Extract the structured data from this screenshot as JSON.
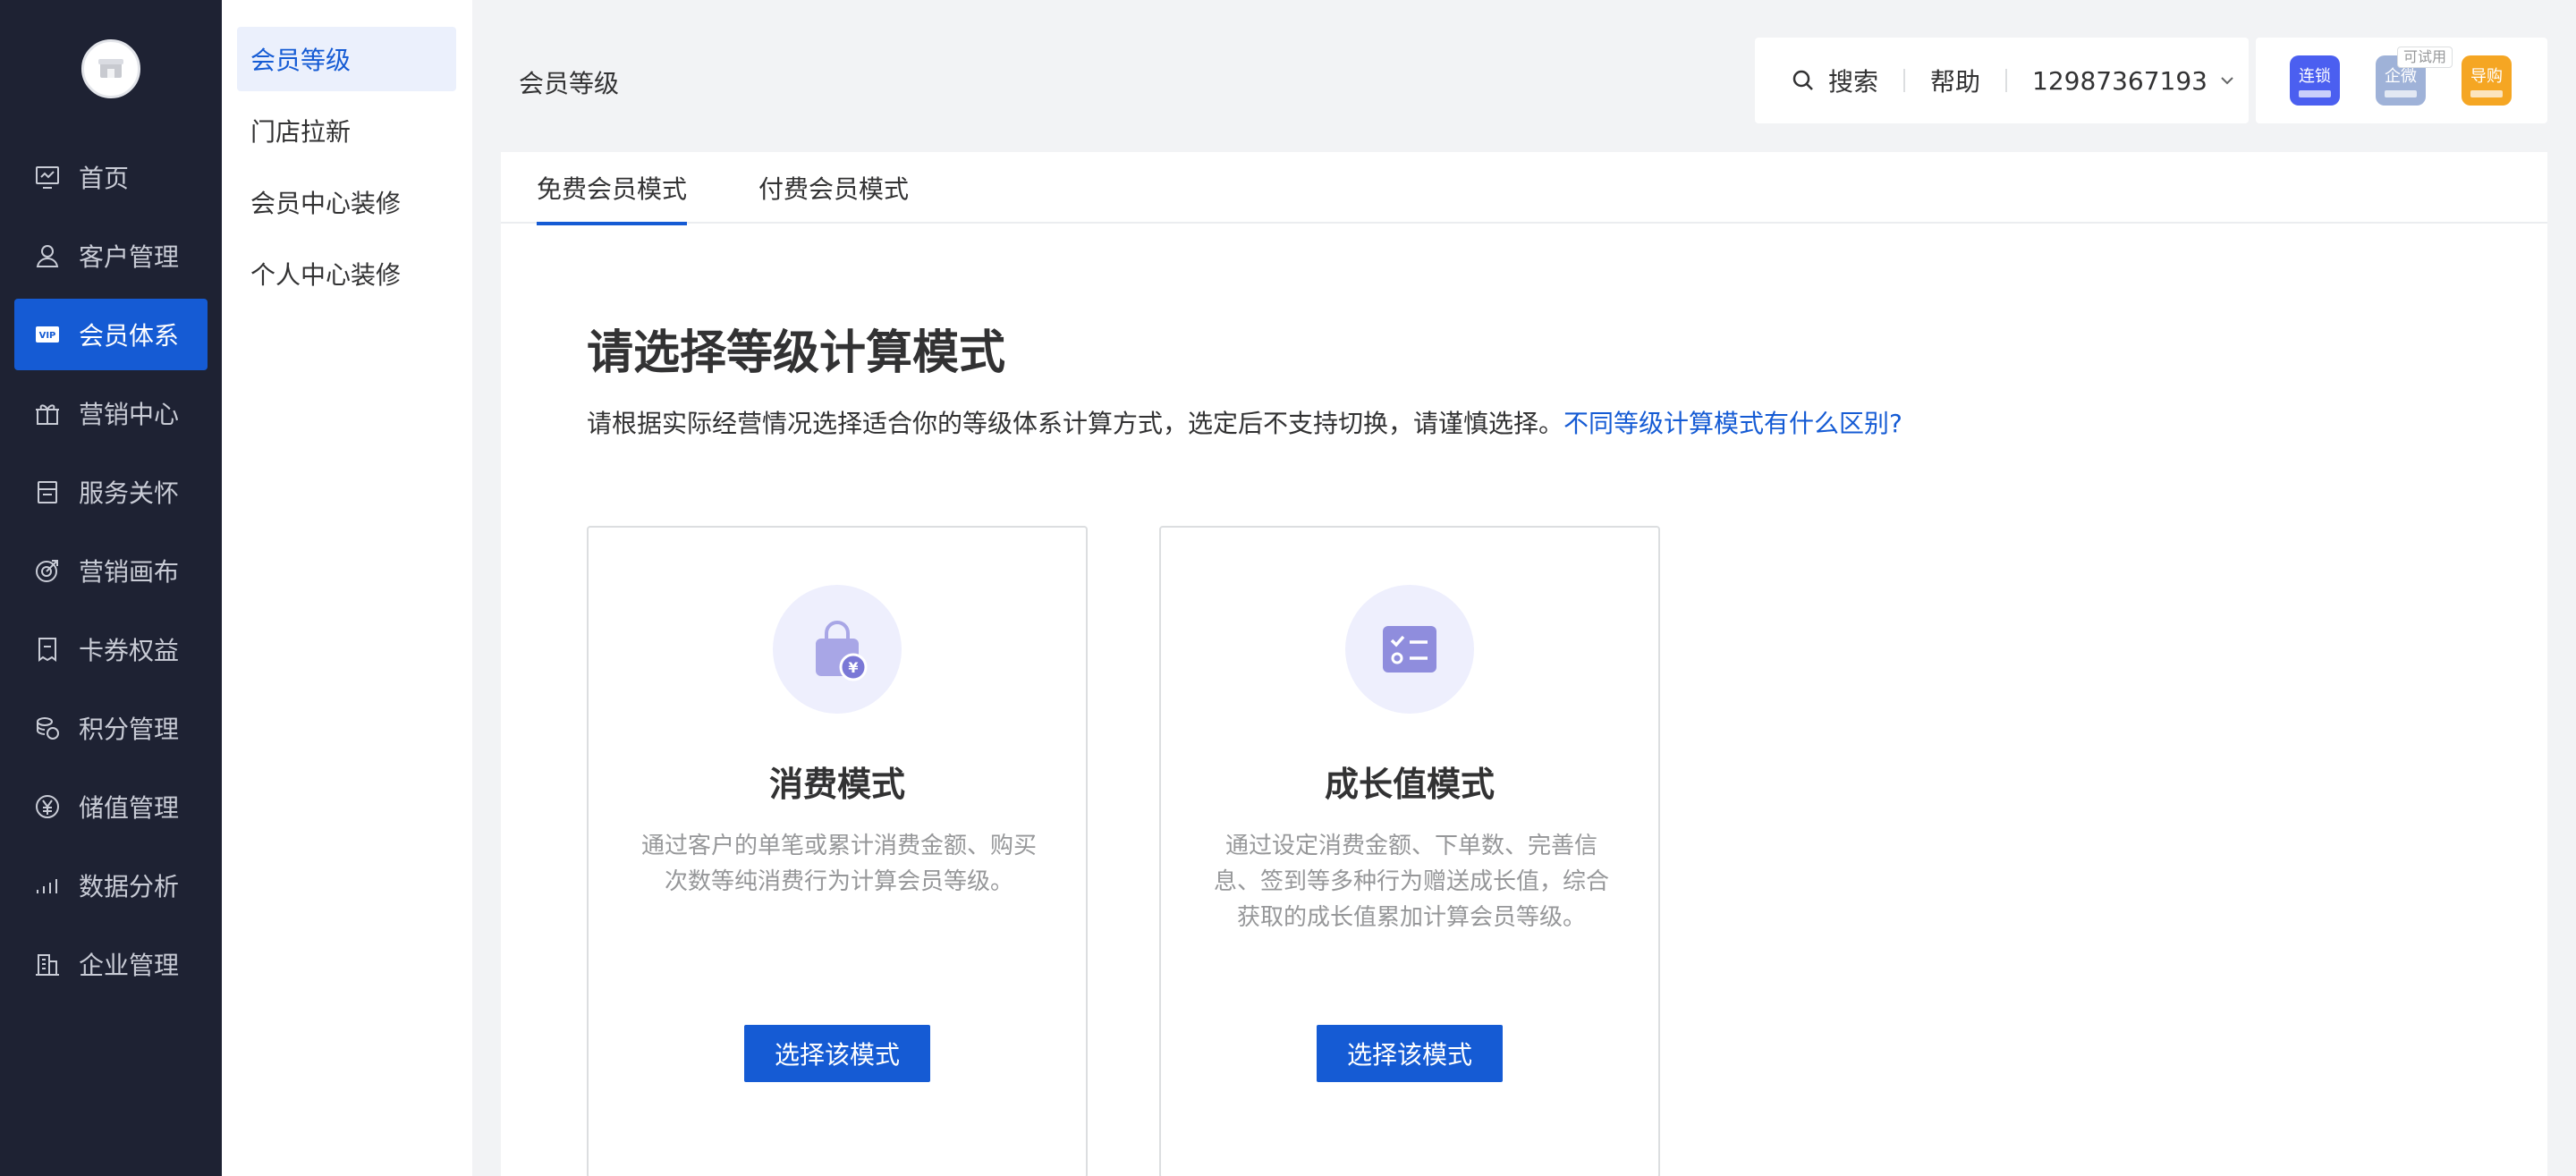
{
  "sidebar": {
    "items": [
      {
        "label": "首页",
        "icon": "dashboard-icon"
      },
      {
        "label": "客户管理",
        "icon": "user-icon"
      },
      {
        "label": "会员体系",
        "icon": "vip-icon"
      },
      {
        "label": "营销中心",
        "icon": "gift-icon"
      },
      {
        "label": "服务关怀",
        "icon": "service-icon"
      },
      {
        "label": "营销画布",
        "icon": "target-icon"
      },
      {
        "label": "卡券权益",
        "icon": "coupon-icon"
      },
      {
        "label": "积分管理",
        "icon": "coins-icon"
      },
      {
        "label": "储值管理",
        "icon": "yuan-icon"
      },
      {
        "label": "数据分析",
        "icon": "chart-icon"
      },
      {
        "label": "企业管理",
        "icon": "building-icon"
      }
    ],
    "active_index": 2
  },
  "subnav": {
    "items": [
      {
        "label": "会员等级"
      },
      {
        "label": "门店拉新"
      },
      {
        "label": "会员中心装修"
      },
      {
        "label": "个人中心装修"
      }
    ],
    "active_index": 0
  },
  "header": {
    "page_title": "会员等级",
    "search_label": "搜索",
    "help_label": "帮助",
    "account": "12987367193"
  },
  "apps": [
    {
      "label": "连锁",
      "color": "#4b5ff0"
    },
    {
      "label": "企微",
      "color": "#9fb2d8",
      "tag": "可试用"
    },
    {
      "label": "导购",
      "color": "#f5a623"
    }
  ],
  "tabs": [
    {
      "label": "免费会员模式"
    },
    {
      "label": "付费会员模式"
    }
  ],
  "content": {
    "heading": "请选择等级计算模式",
    "description": "请根据实际经营情况选择适合你的等级体系计算方式，选定后不支持切换，请谨慎选择。",
    "link": "不同等级计算模式有什么区别?"
  },
  "modes": [
    {
      "title": "消费模式",
      "text": "通过客户的单笔或累计消费金额、购买次数等纯消费行为计算会员等级。",
      "button": "选择该模式",
      "icon": "shopping-bag-icon"
    },
    {
      "title": "成长值模式",
      "text": "通过设定消费金额、下单数、完善信息、签到等多种行为赠送成长值，综合获取的成长值累加计算会员等级。",
      "button": "选择该模式",
      "icon": "checklist-icon"
    }
  ],
  "colors": {
    "sidebar_bg": "#1e2233",
    "accent": "#155bd4"
  }
}
